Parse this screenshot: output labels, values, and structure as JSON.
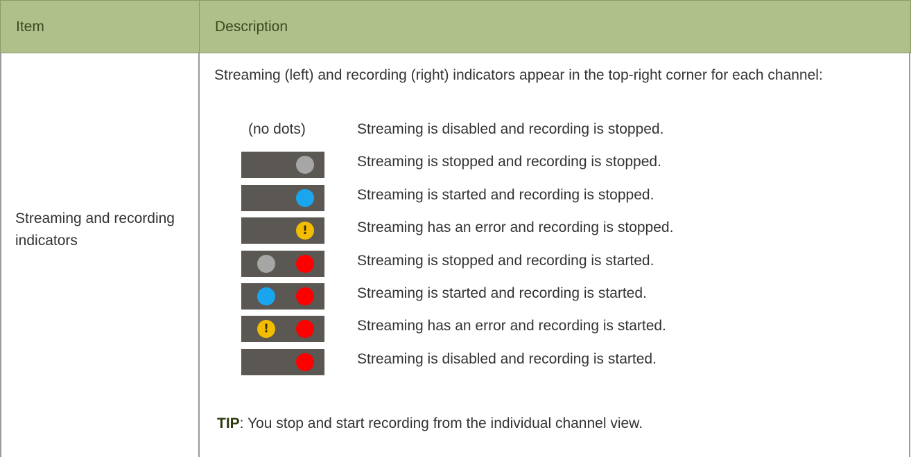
{
  "table": {
    "headers": {
      "item": "Item",
      "description": "Description"
    },
    "row": {
      "item": "Streaming and recording indicators",
      "intro": "Streaming (left) and recording (right) indicators appear in the top-right corner for each channel:",
      "indicators": [
        {
          "left": "none",
          "right": "none",
          "no_dots_label": "(no dots)",
          "text": "Streaming is disabled and recording is stopped."
        },
        {
          "left": "none",
          "right": "gray",
          "text": "Streaming is stopped and recording is stopped."
        },
        {
          "left": "none",
          "right": "blue",
          "text": "Streaming is started and recording is stopped."
        },
        {
          "left": "none",
          "right": "yellow-error",
          "text": "Streaming has an error and recording is stopped."
        },
        {
          "left": "gray",
          "right": "red",
          "text": "Streaming is stopped and recording is started."
        },
        {
          "left": "blue",
          "right": "red",
          "text": "Streaming is started and recording is started."
        },
        {
          "left": "yellow-error",
          "right": "red",
          "text": "Streaming has an error and recording is started."
        },
        {
          "left": "none",
          "right": "red",
          "text": "Streaming is disabled and recording is started."
        }
      ],
      "error_glyph": "!",
      "tip": {
        "label": "TIP",
        "text": ": You stop and start recording from the individual channel view."
      }
    }
  },
  "colors": {
    "header_bg": "#afc08a",
    "indicator_bg": "#5b5752",
    "gray_dot": "#a6a6a6",
    "blue_dot": "#1aa6ee",
    "red_dot": "#ff0000",
    "yellow_dot": "#f2bd00"
  }
}
